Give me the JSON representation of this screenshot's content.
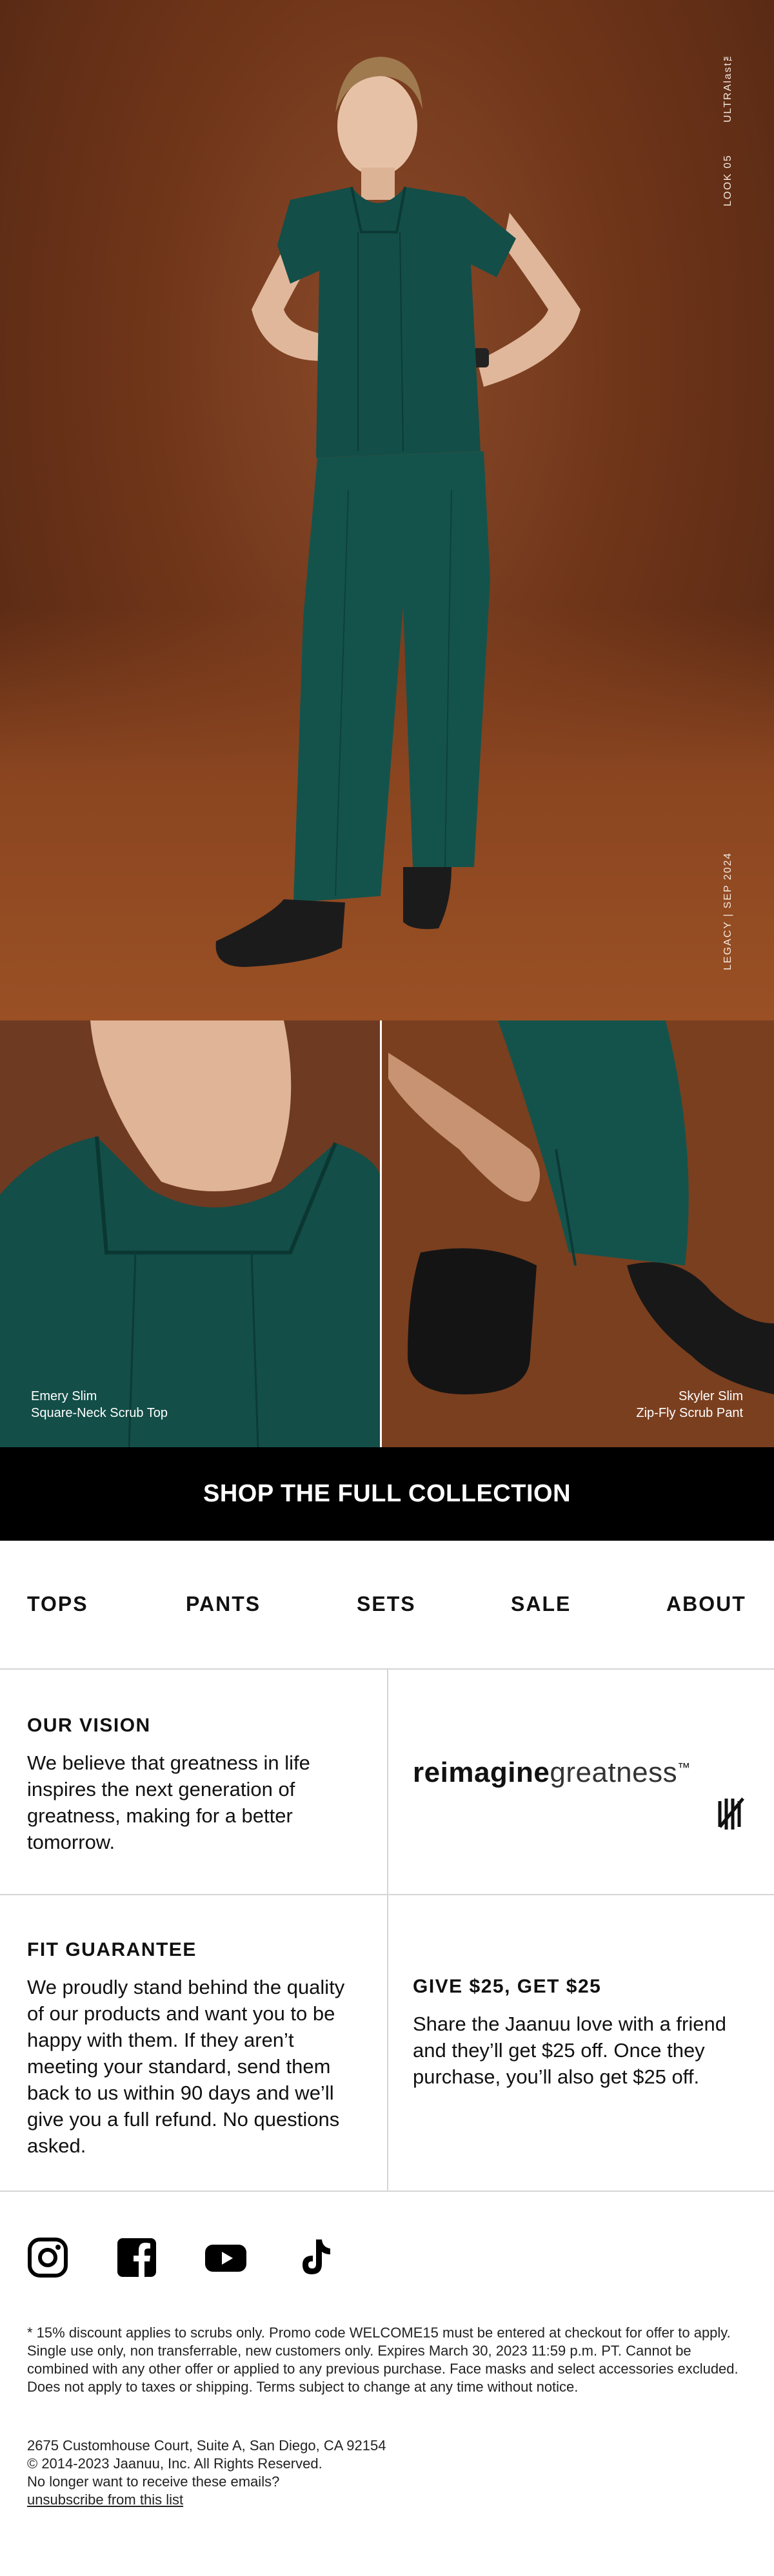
{
  "hero": {
    "vertical_top": "ULTRAlast™",
    "vertical_mid": "LOOK 05",
    "vertical_bottom": "LEGACY | SEP 2024"
  },
  "photos": {
    "left_caption_line1": "Emery Slim",
    "left_caption_line2": "Square-Neck Scrub Top",
    "right_caption_line1": "Skyler Slim",
    "right_caption_line2": "Zip-Fly Scrub Pant"
  },
  "cta": {
    "label": "SHOP THE FULL COLLECTION"
  },
  "nav": {
    "items": [
      "TOPS",
      "PANTS",
      "SETS",
      "SALE",
      "ABOUT"
    ]
  },
  "vision": {
    "title": "OUR VISION",
    "body": "We believe that greatness in life inspires the next generation of greatness, making for a better tomorrow."
  },
  "brand": {
    "word_bold": "reimagine",
    "word_light": "greatness",
    "tm": "™"
  },
  "fit": {
    "title": "FIT GUARANTEE",
    "body": "We proudly stand behind the quality of our products and want you to be happy with them. If they aren’t meeting your standard, send them back to us within 90 days and we’ll give you a full refund. No questions asked."
  },
  "referral": {
    "title": "GIVE $25, GET $25",
    "body": "Share the Jaanuu love with a friend and they’ll get $25 off. Once they purchase, you’ll also get $25 off."
  },
  "social": {
    "icons": [
      "instagram-icon",
      "facebook-icon",
      "youtube-icon",
      "tiktok-icon"
    ]
  },
  "footer": {
    "disclaimer": "* 15% discount applies to scrubs only.  Promo code WELCOME15 must be entered at checkout for offer to apply. Single use only, non transferrable, new customers only. Expires March 30, 2023 11:59 p.m. PT. Cannot be combined with any other offer or applied to any previous purchase. Face masks and select accessories excluded. Does not apply to taxes or shipping. Terms subject to change at any time without notice.",
    "address": "2675 Customhouse Court, Suite A, San Diego, CA 92154",
    "copyright": "© 2014-2023 Jaanuu, Inc. All Rights Reserved.",
    "question": "No longer want to receive these emails?",
    "unsubscribe": "unsubscribe from this list"
  },
  "colors": {
    "scrub_teal": "#134e48",
    "background_brown": "#6f3519",
    "cta_black": "#000000"
  }
}
